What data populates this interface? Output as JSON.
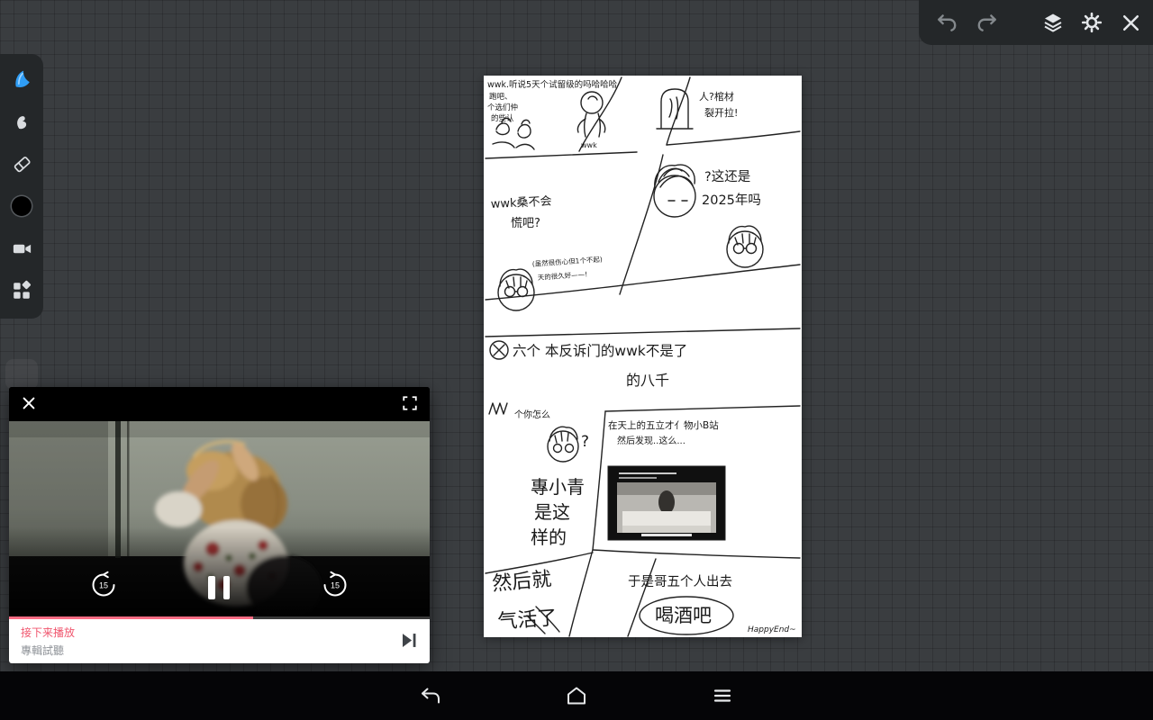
{
  "colors": {
    "accent_blue": "#2f9df5",
    "progress_pink": "#fc6c84",
    "up_next_pink": "#f0566e",
    "toolbar_bg": "#242729",
    "canvas_bg": "#ffffff"
  },
  "top_toolbar": {
    "icons": [
      "undo-icon",
      "redo-icon",
      "layers-icon",
      "settings-icon",
      "close-icon"
    ]
  },
  "tool_sidebar": {
    "icons": [
      "brush-logo-icon",
      "smudge-icon",
      "eraser-icon",
      "color-swatch-black",
      "video-record-icon",
      "widgets-icon"
    ],
    "current_color": "#000000"
  },
  "canvas": {
    "comic": {
      "top_caption": "wwk.听说5天个试留级的吗哈哈哈",
      "p1_line1": "跑吧、",
      "p1_line2": "个选们仲",
      "p1_line3": "的些认",
      "p2_label": "wwk",
      "p3_line1": "人?棺材",
      "p3_line2": "裂开拉!",
      "p4_line1": "?这还是",
      "p4_line2": "2025年吗",
      "p5_line1": "wwk桑不会",
      "p5_line2": "慌吧?",
      "p5_note1": "(虽然很伤心但1个不起)",
      "p5_note2": "天的很久好——!",
      "p6_main": "六个 本反诉门的wwk不是了",
      "p6_sub": "的八千",
      "p7_text": "个你怎么",
      "p7_q": "?",
      "p8_line1": "在天上的五立才亻物小B站",
      "p8_line2": "然后发现..这么...",
      "p9_line1": "專小青",
      "p9_line2": "是这",
      "p9_line3": "样的",
      "p10_line1": "然后就",
      "p10_line2": "气活了",
      "p11_line1": "于是哥五个人出去",
      "p11_line2": "喝酒吧",
      "signature": "HappyEnd~"
    }
  },
  "video_player": {
    "up_next_label": "接下来播放",
    "up_next_title": "專輯試聽",
    "rewind_seconds": "15",
    "forward_seconds": "15",
    "progress_percent": 58
  },
  "nav_bar": {
    "icons": [
      "back-icon",
      "home-icon",
      "menu-icon"
    ]
  }
}
